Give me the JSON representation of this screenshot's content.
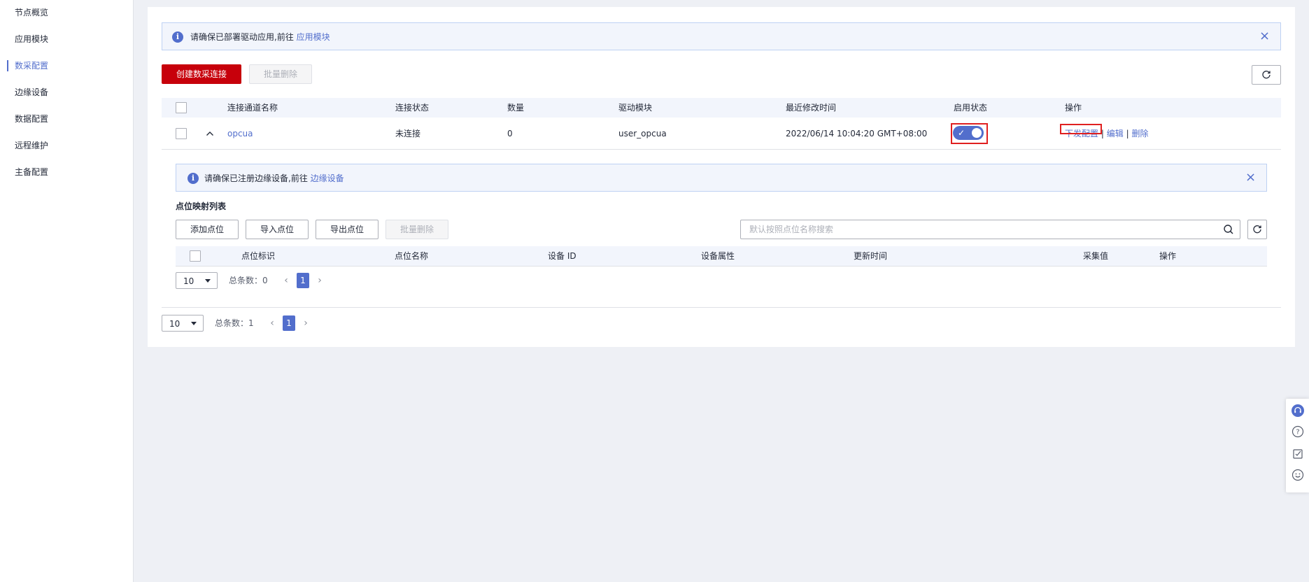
{
  "sidebar": {
    "items": [
      {
        "label": "节点概览"
      },
      {
        "label": "应用模块"
      },
      {
        "label": "数采配置",
        "active": true
      },
      {
        "label": "边缘设备"
      },
      {
        "label": "数据配置"
      },
      {
        "label": "远程维护"
      },
      {
        "label": "主备配置"
      }
    ]
  },
  "top_alert": {
    "text": "请确保已部署驱动应用,前往 ",
    "link": "应用模块"
  },
  "toolbar": {
    "create_label": "创建数采连接",
    "batch_delete_label": "批量删除"
  },
  "conn_table": {
    "headers": [
      "连接通道名称",
      "连接状态",
      "数量",
      "驱动模块",
      "最近修改时间",
      "启用状态",
      "操作"
    ],
    "rows": [
      {
        "name": "opcua",
        "status": "未连接",
        "count": "0",
        "driver": "user_opcua",
        "modified": "2022/06/14 10:04:20 GMT+08:00",
        "enabled": true,
        "actions": {
          "deploy": "下发配置",
          "sep": "|",
          "edit": "编辑",
          "delete": "删除"
        }
      }
    ]
  },
  "inner_alert": {
    "text": "请确保已注册边缘设备,前往 ",
    "link": "边缘设备"
  },
  "point_section": {
    "title": "点位映射列表",
    "add_label": "添加点位",
    "import_label": "导入点位",
    "export_label": "导出点位",
    "batch_delete_label": "批量删除",
    "search_placeholder": "默认按照点位名称搜索",
    "headers": [
      "点位标识",
      "点位名称",
      "设备 ID",
      "设备属性",
      "更新时间",
      "采集值",
      "操作"
    ],
    "pager": {
      "page_size": "10",
      "total": "总条数：0",
      "current": "1"
    }
  },
  "pager": {
    "page_size": "10",
    "total": "总条数：1",
    "current": "1"
  },
  "colors": {
    "primary": "#526ecc",
    "danger": "#c7000b",
    "highlight": "#e02020"
  },
  "icons": [
    "info-icon",
    "close-icon",
    "refresh-icon",
    "chevron-up-icon",
    "search-icon",
    "headset-icon",
    "question-icon",
    "feedback-icon",
    "smile-icon"
  ]
}
